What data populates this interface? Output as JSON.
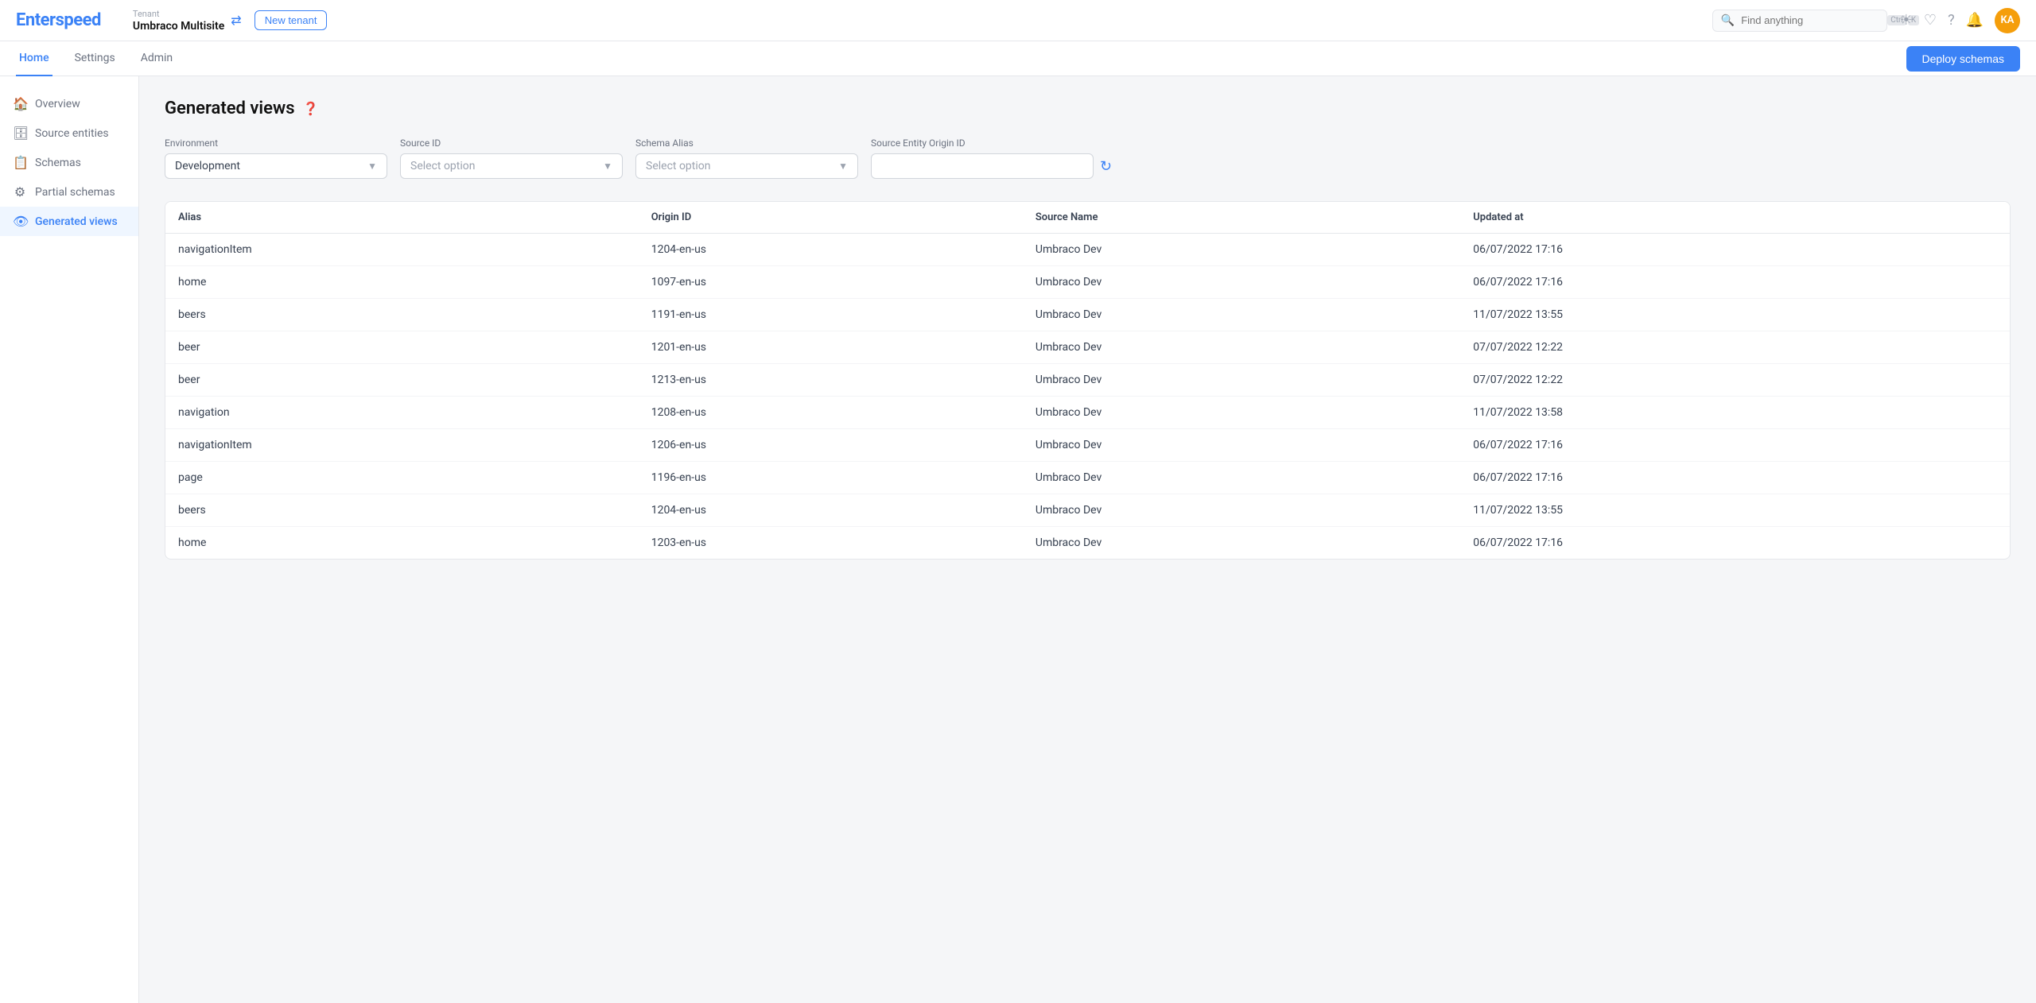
{
  "logo": {
    "text_black": "Enter",
    "text_blue": "speed"
  },
  "tenant": {
    "label": "Tenant",
    "name": "Umbraco Multisite"
  },
  "buttons": {
    "new_tenant": "New tenant",
    "deploy_schemas": "Deploy schemas"
  },
  "search": {
    "placeholder": "Find anything",
    "shortcut_ctrl": "Ctrl",
    "shortcut_key": "K"
  },
  "nav": {
    "tabs": [
      {
        "id": "home",
        "label": "Home",
        "active": true
      },
      {
        "id": "settings",
        "label": "Settings",
        "active": false
      },
      {
        "id": "admin",
        "label": "Admin",
        "active": false
      }
    ]
  },
  "sidebar": {
    "items": [
      {
        "id": "overview",
        "label": "Overview",
        "icon": "🏠"
      },
      {
        "id": "source-entities",
        "label": "Source entities",
        "icon": "🗄"
      },
      {
        "id": "schemas",
        "label": "Schemas",
        "icon": "📋"
      },
      {
        "id": "partial-schemas",
        "label": "Partial schemas",
        "icon": "⚙"
      },
      {
        "id": "generated-views",
        "label": "Generated views",
        "icon": "👁",
        "active": true
      }
    ]
  },
  "page": {
    "title": "Generated views"
  },
  "filters": {
    "environment": {
      "label": "Environment",
      "value": "Development"
    },
    "source_id": {
      "label": "Source ID",
      "placeholder": "Select option"
    },
    "schema_alias": {
      "label": "Schema Alias",
      "placeholder": "Select option"
    },
    "source_entity_origin_id": {
      "label": "Source Entity Origin ID",
      "placeholder": ""
    }
  },
  "table": {
    "columns": [
      {
        "id": "alias",
        "label": "Alias"
      },
      {
        "id": "origin_id",
        "label": "Origin ID"
      },
      {
        "id": "source_name",
        "label": "Source Name"
      },
      {
        "id": "updated_at",
        "label": "Updated at"
      }
    ],
    "rows": [
      {
        "alias": "navigationItem",
        "origin_id": "1204-en-us",
        "source_name": "Umbraco Dev",
        "updated_at": "06/07/2022 17:16"
      },
      {
        "alias": "home",
        "origin_id": "1097-en-us",
        "source_name": "Umbraco Dev",
        "updated_at": "06/07/2022 17:16"
      },
      {
        "alias": "beers",
        "origin_id": "1191-en-us",
        "source_name": "Umbraco Dev",
        "updated_at": "11/07/2022 13:55"
      },
      {
        "alias": "beer",
        "origin_id": "1201-en-us",
        "source_name": "Umbraco Dev",
        "updated_at": "07/07/2022 12:22"
      },
      {
        "alias": "beer",
        "origin_id": "1213-en-us",
        "source_name": "Umbraco Dev",
        "updated_at": "07/07/2022 12:22"
      },
      {
        "alias": "navigation",
        "origin_id": "1208-en-us",
        "source_name": "Umbraco Dev",
        "updated_at": "11/07/2022 13:58"
      },
      {
        "alias": "navigationItem",
        "origin_id": "1206-en-us",
        "source_name": "Umbraco Dev",
        "updated_at": "06/07/2022 17:16"
      },
      {
        "alias": "page",
        "origin_id": "1196-en-us",
        "source_name": "Umbraco Dev",
        "updated_at": "06/07/2022 17:16"
      },
      {
        "alias": "beers",
        "origin_id": "1204-en-us",
        "source_name": "Umbraco Dev",
        "updated_at": "11/07/2022 13:55"
      },
      {
        "alias": "home",
        "origin_id": "1203-en-us",
        "source_name": "Umbraco Dev",
        "updated_at": "06/07/2022 17:16"
      }
    ]
  },
  "avatar": {
    "initials": "KA"
  }
}
